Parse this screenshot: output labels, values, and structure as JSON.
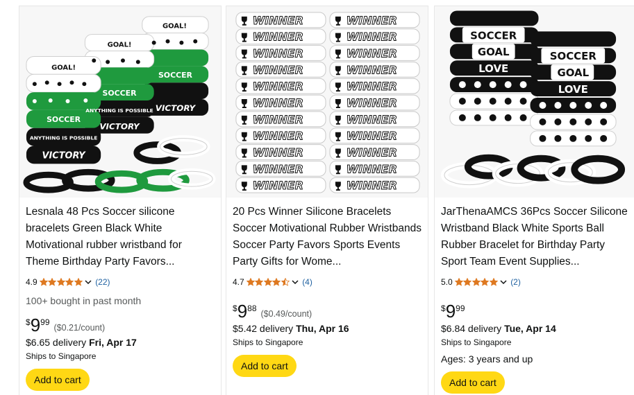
{
  "products": [
    {
      "image_icon": "soccer-bracelets-green-black-white",
      "title": "Lesnala 48 Pcs Soccer silicone bracelets Green Black White Motivational rubber wristband for Theme Birthday Party Favors...",
      "rating": "4.9",
      "stars": 5,
      "reviews": "(22)",
      "bought": "100+ bought in past month",
      "price_symbol": "$",
      "price_whole": "9",
      "price_fraction": "99",
      "unit_price": "($0.21/count)",
      "delivery_prefix": "$6.65 delivery ",
      "delivery_date": "Fri, Apr 17",
      "ships_to": "Ships to Singapore",
      "ages": "",
      "cart_label": "Add to cart"
    },
    {
      "image_icon": "winner-bracelets-white",
      "title": "20 Pcs Winner Silicone Bracelets Soccer Motivational Rubber Wristbands Soccer Party Favors Sports Events Party Gifts for Wome...",
      "rating": "4.7",
      "stars": 4.5,
      "reviews": "(4)",
      "bought": "",
      "price_symbol": "$",
      "price_whole": "9",
      "price_fraction": "88",
      "unit_price": "($0.49/count)",
      "delivery_prefix": "$5.42 delivery ",
      "delivery_date": "Thu, Apr 16",
      "ships_to": "Ships to Singapore",
      "ages": "",
      "cart_label": "Add to cart"
    },
    {
      "image_icon": "soccer-goal-love-bracelets",
      "title": "JarThenaAMCS 36Pcs Soccer Silicone Wristband Black White Sports Ball Rubber Bracelet for Birthday Party Sport Team Event Supplies...",
      "rating": "5.0",
      "stars": 5,
      "reviews": "(2)",
      "bought": "",
      "price_symbol": "$",
      "price_whole": "9",
      "price_fraction": "99",
      "unit_price": "",
      "delivery_prefix": "$6.84 delivery ",
      "delivery_date": "Tue, Apr 14",
      "ships_to": "Ships to Singapore",
      "ages": "Ages: 3 years and up",
      "cart_label": "Add to cart"
    }
  ],
  "colors": {
    "star": "#de7921",
    "link": "#2162a1",
    "button": "#FFD814",
    "secondary_text": "#565959",
    "bracelet_green": "#1f9a3e",
    "bracelet_black": "#111111"
  },
  "bracelet_text": {
    "goal": "GOAL!",
    "soccer": "SOCCER",
    "possible": "ANYTHING IS POSSIBLE",
    "victory": "VICTORY",
    "winner": "WINNER",
    "goal_plain": "GOAL",
    "love": "LOVE"
  }
}
